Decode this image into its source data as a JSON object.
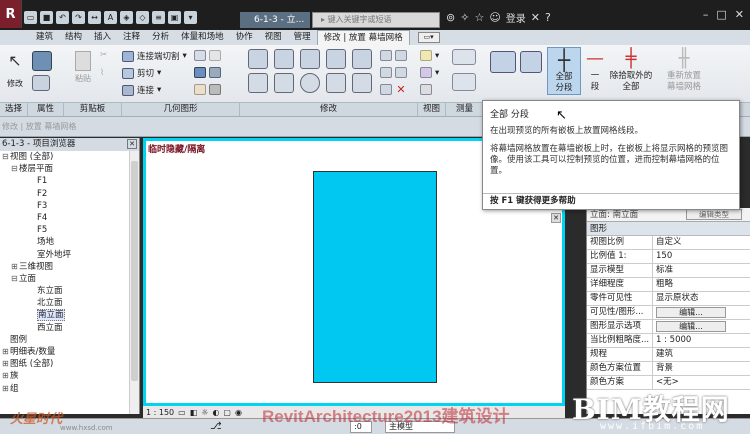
{
  "titlebar": {
    "doc_title": "6-1-3 - 立...",
    "search_placeholder": "键入关键字或短语",
    "signin": "登录"
  },
  "tabs": [
    "建筑",
    "结构",
    "插入",
    "注释",
    "分析",
    "体量和场地",
    "协作",
    "视图",
    "管理",
    "修改 | 放置 幕墙网格"
  ],
  "ribbon": {
    "modify_label": "修改",
    "paste_label": "粘贴",
    "clipboard": {
      "connect_cut": "连接端切割",
      "cut": "剪切",
      "join": "连接"
    },
    "curtain_grid": {
      "all_segments": "全部\n分段",
      "one_segment": "一\n段",
      "all_except": "除拾取外的\n全部",
      "replace": "重新放置\n幕墙网格"
    }
  },
  "panel_labels": [
    "选择",
    "属性",
    "剪贴板",
    "几何图形",
    "修改",
    "视图",
    "测量",
    "创建"
  ],
  "options_bar": "修改 | 放置 幕墙网格",
  "browser": {
    "title": "6-1-3 - 项目浏览器",
    "tree": [
      {
        "label": "视图 (全部)",
        "indent": 0,
        "exp": "-"
      },
      {
        "label": "楼层平面",
        "indent": 1,
        "exp": "-"
      },
      {
        "label": "F1",
        "indent": 3
      },
      {
        "label": "F2",
        "indent": 3
      },
      {
        "label": "F3",
        "indent": 3
      },
      {
        "label": "F4",
        "indent": 3
      },
      {
        "label": "F5",
        "indent": 3
      },
      {
        "label": "场地",
        "indent": 3
      },
      {
        "label": "室外地坪",
        "indent": 3
      },
      {
        "label": "三维视图",
        "indent": 1,
        "exp": "+"
      },
      {
        "label": "立面",
        "indent": 1,
        "exp": "-"
      },
      {
        "label": "东立面",
        "indent": 3
      },
      {
        "label": "北立面",
        "indent": 3
      },
      {
        "label": "南立面",
        "indent": 3,
        "selected": true
      },
      {
        "label": "西立面",
        "indent": 3
      },
      {
        "label": "图例",
        "indent": 0
      },
      {
        "label": "明细表/数量",
        "indent": 0,
        "exp": "+"
      },
      {
        "label": "图纸 (全部)",
        "indent": 0,
        "exp": "+"
      },
      {
        "label": "族",
        "indent": 0,
        "exp": "+"
      },
      {
        "label": "组",
        "indent": 0,
        "exp": "+"
      }
    ]
  },
  "drawing": {
    "temp_label": "临时隐藏/隔离"
  },
  "viewbar": {
    "scale": "1 : 150"
  },
  "tooltip": {
    "title": "全部 分段",
    "line": "在出现预览的所有嵌板上放置网格线段。",
    "body": "将幕墙网格放置在幕墙嵌板上时，在嵌板上将显示网格的预览图像。使用该工具可以控制预览的位置，进而控制幕墙网格的位置。",
    "help": "按 F1 键获得更多帮助"
  },
  "properties": {
    "type_selector": "立面: 南立面",
    "edit_type": "编辑类型",
    "section": "图形",
    "rows": [
      {
        "k": "视图比例",
        "v": "自定义"
      },
      {
        "k": "比例值 1:",
        "v": "150"
      },
      {
        "k": "显示模型",
        "v": "标准"
      },
      {
        "k": "详细程度",
        "v": "粗略"
      },
      {
        "k": "零件可见性",
        "v": "显示原状态"
      },
      {
        "k": "可见性/图形...",
        "v": "编辑...",
        "btn": true
      },
      {
        "k": "图形显示选项",
        "v": "编辑...",
        "btn": true
      },
      {
        "k": "当比例粗略度...",
        "v": "1 : 5000"
      },
      {
        "k": "规程",
        "v": "建筑"
      },
      {
        "k": "颜色方案位置",
        "v": "背景"
      },
      {
        "k": "颜色方案",
        "v": "<无>"
      }
    ]
  },
  "statusbar": {
    "coord": ":0",
    "model": "主模型"
  },
  "watermarks": {
    "red": "RevitArchitecture2013建筑设计",
    "logo": "火星时代",
    "logo_sub": "www.hxsd.com",
    "bim": "BIM教程网",
    "url": "www.ifbim.com"
  },
  "colors": {
    "accent": "#00d4f0",
    "panel": "#00c8f0",
    "active_btn": "#bcd6ee"
  }
}
